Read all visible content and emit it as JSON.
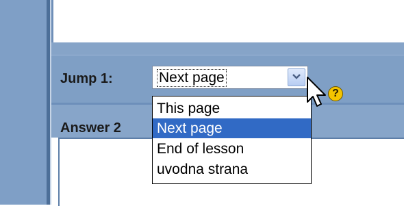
{
  "jump": {
    "label": "Jump 1",
    "colon": ":",
    "selected_value": "Next page",
    "options": [
      "This page",
      "Next page",
      "End of lesson",
      "uvodna strana"
    ],
    "highlighted_index": 1
  },
  "answer": {
    "label": "Answer 2"
  },
  "help": {
    "icon": "help-icon",
    "glyph": "?"
  },
  "colors": {
    "accent": "#7f9fc5",
    "highlight": "#316ac5",
    "help_icon": "#f4c400"
  }
}
